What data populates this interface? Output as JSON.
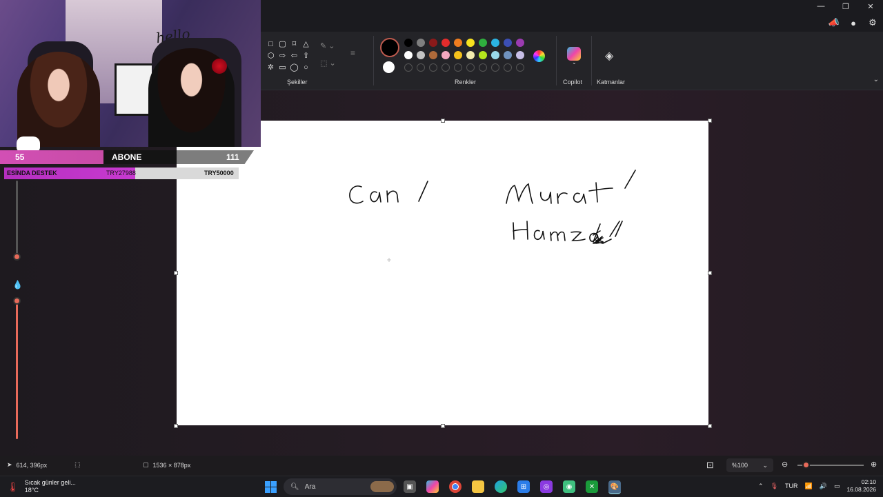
{
  "window": {
    "controls": [
      "—",
      "❐",
      "✕"
    ]
  },
  "top_icons": [
    "megaphone-icon",
    "account-icon",
    "settings-icon"
  ],
  "ribbon": {
    "shapes_label": "Şekiller",
    "colors_label": "Renkler",
    "copilot_label": "Copilot",
    "layers_label": "Katmanlar",
    "palette_row1": [
      "#000000",
      "#7f7f7f",
      "#8b1a1a",
      "#e42c2c",
      "#f07d1f",
      "#f7e21f",
      "#2fae3e",
      "#2bb4e3",
      "#3c4fb5",
      "#9b3bb0"
    ],
    "palette_row2": [
      "#ffffff",
      "#c3c3c3",
      "#b06a3a",
      "#f4a8c0",
      "#f5c21b",
      "#f3ecae",
      "#b5e61d",
      "#99d9ea",
      "#7092be",
      "#c8bfe7"
    ]
  },
  "canvas": {
    "drawn_text": [
      "Can /",
      "Murat /",
      "Hamza //"
    ]
  },
  "stream_overlay": {
    "hello_text": "hello",
    "stat_left": "55",
    "stat_mid": "ABONE",
    "stat_right": "111",
    "donation_label": "ESİNDA DESTEK",
    "donation_current": "TRY27988",
    "donation_goal": "TRY50000",
    "donation_fraction": 0.56
  },
  "statusbar": {
    "cursor_pos": "614, 396px",
    "canvas_size": "1536 × 878px",
    "zoom": "%100"
  },
  "taskbar": {
    "weather_title": "Sıcak günler geli...",
    "weather_temp": "18°C",
    "search_placeholder": "Ara",
    "language": "TUR",
    "time": "02:10",
    "date": "16.08.2026"
  }
}
